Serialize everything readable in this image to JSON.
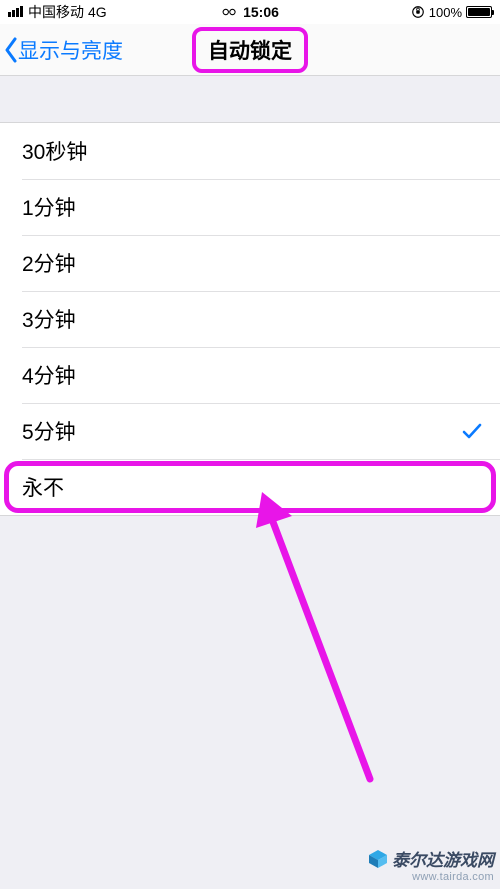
{
  "status_bar": {
    "carrier": "中国移动",
    "network": "4G",
    "time": "15:06",
    "battery_pct": "100%"
  },
  "nav": {
    "back_label": "显示与亮度",
    "title": "自动锁定"
  },
  "options": [
    {
      "label": "30秒钟",
      "selected": false
    },
    {
      "label": "1分钟",
      "selected": false
    },
    {
      "label": "2分钟",
      "selected": false
    },
    {
      "label": "3分钟",
      "selected": false
    },
    {
      "label": "4分钟",
      "selected": false
    },
    {
      "label": "5分钟",
      "selected": true
    },
    {
      "label": "永不",
      "selected": false
    }
  ],
  "annotation": {
    "highlight_color": "#e815e8",
    "arrow_from": "bottom-right",
    "arrow_to": "row-永不"
  },
  "watermark": {
    "brand": "泰尔达游戏网",
    "url": "www.tairda.com"
  }
}
